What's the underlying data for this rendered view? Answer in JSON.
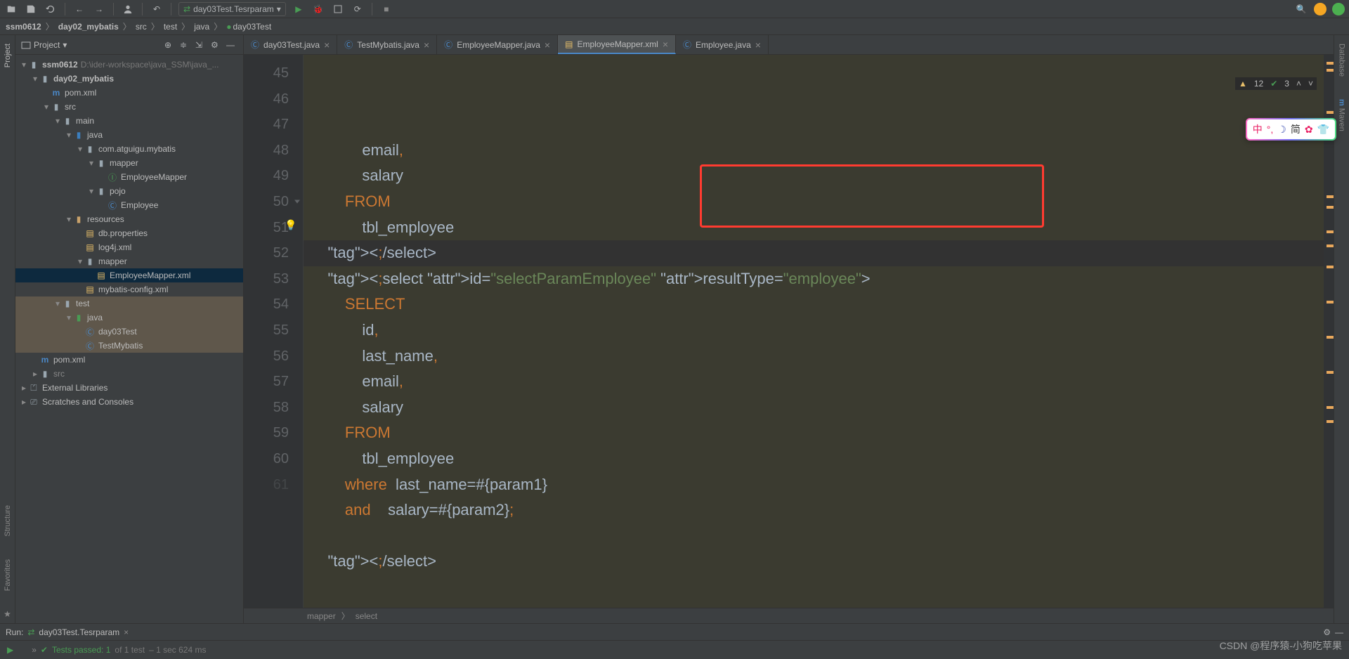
{
  "toolbar": {
    "run_config": "day03Test.Tesrparam",
    "search_icon": "search"
  },
  "breadcrumb": [
    "ssm0612",
    "day02_mybatis",
    "src",
    "test",
    "java",
    "day03Test"
  ],
  "project_panel": {
    "title": "Project",
    "root": {
      "name": "ssm0612",
      "path": "D:\\ider-workspace\\java_SSM\\java_..."
    },
    "nodes": {
      "day02": "day02_mybatis",
      "pom1": "pom.xml",
      "src": "src",
      "main": "main",
      "java1": "java",
      "pkg": "com.atguigu.mybatis",
      "mapper": "mapper",
      "empMapper": "EmployeeMapper",
      "pojo": "pojo",
      "employee": "Employee",
      "resources": "resources",
      "dbprops": "db.properties",
      "log4j": "log4j.xml",
      "mapper2": "mapper",
      "empMapperXml": "EmployeeMapper.xml",
      "myconfig": "mybatis-config.xml",
      "test": "test",
      "java2": "java",
      "day03t": "day03Test",
      "testMy": "TestMybatis",
      "pom2": "pom.xml",
      "src2": "src",
      "extlib": "External Libraries",
      "scratch": "Scratches and Consoles"
    }
  },
  "tabs": [
    {
      "label": "day03Test.java",
      "icon": "class",
      "active": false
    },
    {
      "label": "TestMybatis.java",
      "icon": "class",
      "active": false
    },
    {
      "label": "EmployeeMapper.java",
      "icon": "class",
      "active": false
    },
    {
      "label": "EmployeeMapper.xml",
      "icon": "xml",
      "active": true
    },
    {
      "label": "Employee.java",
      "icon": "class",
      "active": false
    }
  ],
  "editor": {
    "line_start": 45,
    "lines": [
      "            email,",
      "            salary",
      "        FROM",
      "            tbl_employee",
      "    </select>",
      "    <select id=\"selectParamEmployee\" resultType=\"employee\">",
      "        SELECT",
      "            id,",
      "            last_name,",
      "            email,",
      "            salary",
      "        FROM",
      "            tbl_employee",
      "        where  last_name=#{param1}",
      "        and    salary=#{param2};",
      "",
      "    </select>"
    ],
    "status": {
      "warn": "12",
      "ok": "3"
    },
    "bottom_crumb": [
      "mapper",
      "select"
    ]
  },
  "run": {
    "label": "Run:",
    "config": "day03Test.Tesrparam",
    "result_prefix": "Tests passed:",
    "result_count": "1",
    "result_of": "of 1 test",
    "result_time": "– 1 sec 624 ms"
  },
  "rails": {
    "left": [
      "Project",
      "Structure",
      "Favorites"
    ],
    "right": [
      "Database",
      "Maven"
    ]
  },
  "watermark": "CSDN @程序猿-小狗吃苹果",
  "ime": {
    "zh": "中",
    "pin": "简"
  }
}
